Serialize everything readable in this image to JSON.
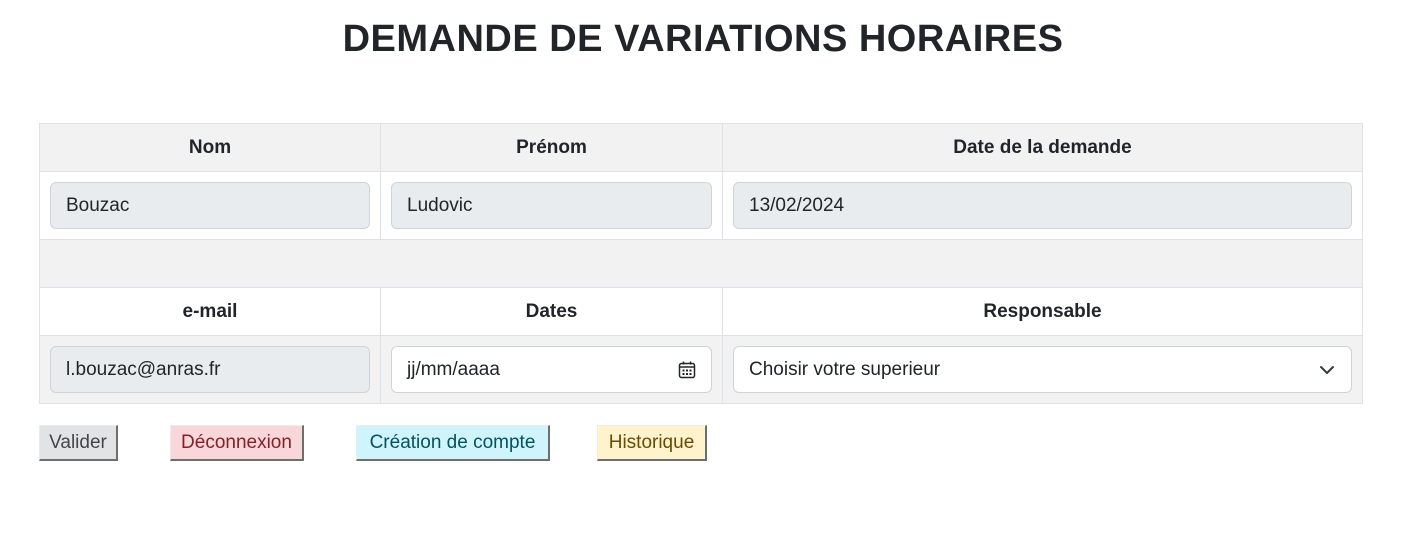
{
  "page": {
    "title": "DEMANDE DE VARIATIONS HORAIRES"
  },
  "form": {
    "headers_row1": {
      "nom": "Nom",
      "prenom": "Prénom",
      "date_demande": "Date de la demande"
    },
    "values_row1": {
      "nom": "Bouzac",
      "prenom": "Ludovic",
      "date_demande": "13/02/2024"
    },
    "headers_row2": {
      "email": "e-mail",
      "dates": "Dates",
      "responsable": "Responsable"
    },
    "values_row2": {
      "email": "l.bouzac@anras.fr",
      "dates_placeholder": "jj/mm/aaaa",
      "responsable_selected": "Choisir votre superieur"
    }
  },
  "actions": {
    "valider": "Valider",
    "deconnexion": "Déconnexion",
    "creation_compte": "Création de compte",
    "historique": "Historique"
  },
  "icons": {
    "date_picker": "calendar-icon",
    "select_arrow": "chevron-down-icon"
  },
  "colors": {
    "valider_bg": "#e2e3e5",
    "deconnexion_bg": "#f8d7da",
    "creation_bg": "#cff4fc",
    "historique_bg": "#fff3cd",
    "readonly_bg": "#e9ecef",
    "table_stripe": "#f2f2f2"
  }
}
